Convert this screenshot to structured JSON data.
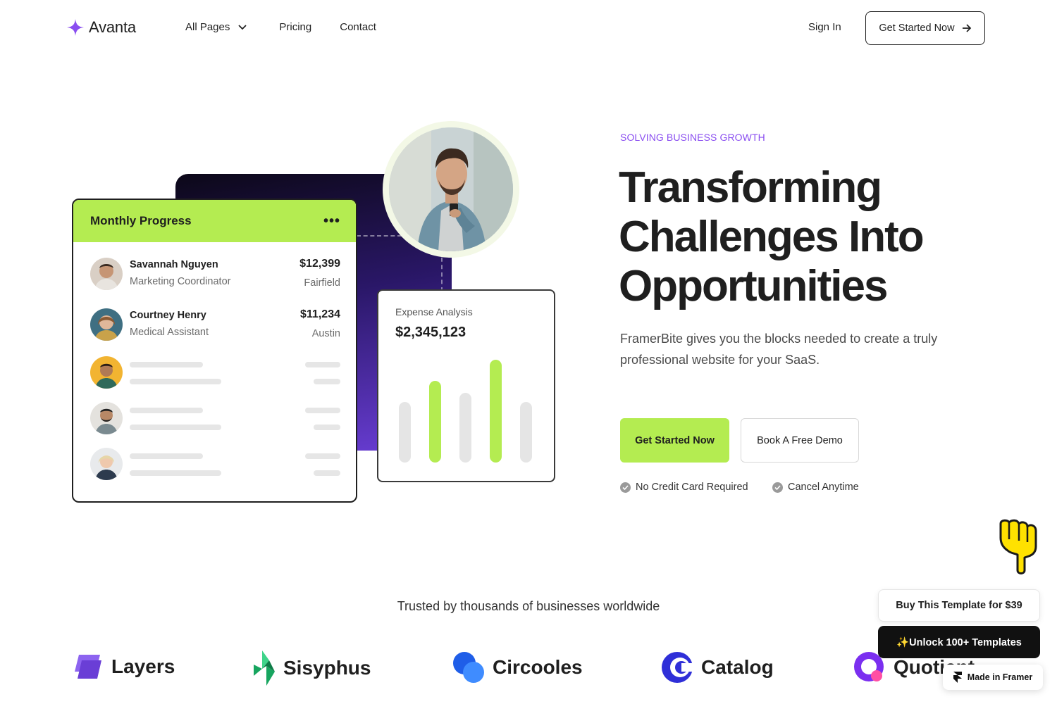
{
  "brand": {
    "name": "Avanta",
    "accent": "#8a4ef0",
    "lime": "#b4ec51"
  },
  "nav": {
    "links": [
      {
        "label": "All Pages",
        "has_dropdown": true
      },
      {
        "label": "Pricing"
      },
      {
        "label": "Contact"
      }
    ],
    "sign_in": "Sign In",
    "cta": "Get Started Now"
  },
  "progress_card": {
    "title": "Monthly Progress",
    "people": [
      {
        "name": "Savannah Nguyen",
        "role": "Marketing Coordinator",
        "amount": "$12,399",
        "city": "Fairfield"
      },
      {
        "name": "Courtney Henry",
        "role": "Medical Assistant",
        "amount": "$11,234",
        "city": "Austin"
      }
    ]
  },
  "expense_card": {
    "label": "Expense Analysis",
    "value": "$2,345,123"
  },
  "hero": {
    "eyebrow": "SOLVING BUSINESS GROWTH",
    "headline_lines": [
      "Transforming",
      "Challenges Into",
      "Opportunities"
    ],
    "subtitle": "FramerBite gives you the blocks needed to create a truly professional website for your SaaS.",
    "primary_cta": "Get Started Now",
    "secondary_cta": "Book A Free Demo",
    "perks": [
      "No Credit Card Required",
      "Cancel Anytime"
    ]
  },
  "trust": {
    "heading": "Trusted by thousands of businesses worldwide",
    "logos": [
      "Layers",
      "Sisyphus",
      "Circooles",
      "Catalog",
      "Quotient"
    ]
  },
  "floating": {
    "buy": "Buy This Template for $39",
    "unlock": "✨Unlock 100+ Templates",
    "made_in": "Made in Framer"
  }
}
